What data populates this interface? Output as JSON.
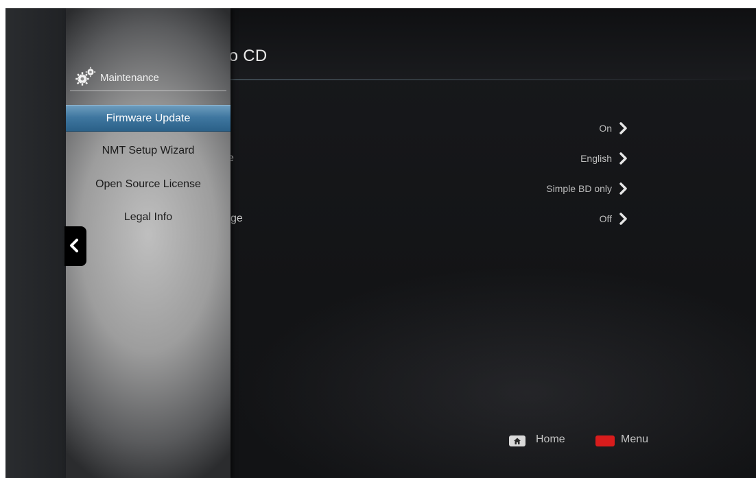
{
  "page": {
    "title_partial": "io CD"
  },
  "settings": [
    {
      "label_stub": "",
      "value": "On"
    },
    {
      "label_stub": "e",
      "value": "English"
    },
    {
      "label_stub": "",
      "value": "Simple BD only"
    },
    {
      "label_stub": "ge",
      "value": "Off"
    }
  ],
  "side_panel": {
    "header": "Maintenance",
    "header_icon": "gears-icon",
    "items": [
      {
        "label": "Firmware Update",
        "selected": true
      },
      {
        "label": "NMT Setup Wizard",
        "selected": false
      },
      {
        "label": "Open Source License",
        "selected": false
      },
      {
        "label": "Legal Info",
        "selected": false
      }
    ]
  },
  "footer": {
    "home_label": "Home",
    "menu_label": "Menu",
    "home_icon": "home-icon",
    "menu_key_color": "#d81c1c"
  },
  "colors": {
    "selection_accent": "#3f77a0"
  }
}
